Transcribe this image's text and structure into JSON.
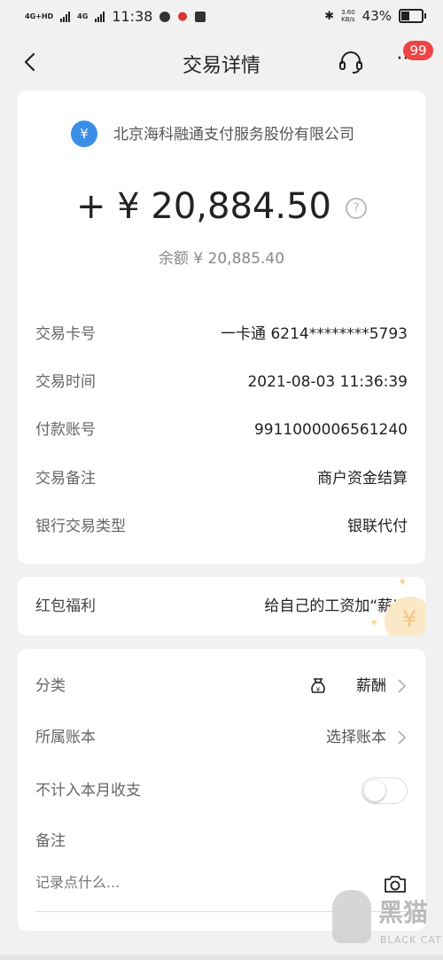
{
  "status_bar": {
    "net1": "4G+HD",
    "net2": "4G",
    "time": "11:38",
    "speed_value": "3.60",
    "speed_unit": "KB/s",
    "battery": "43%"
  },
  "header": {
    "title": "交易详情",
    "badge": "99"
  },
  "summary": {
    "merchant_icon": "¥",
    "merchant": "北京海科融通支付服务股份有限公司",
    "amount": "+ ¥ 20,884.50",
    "balance": "余额 ¥ 20,885.40"
  },
  "details": [
    {
      "label": "交易卡号",
      "value": "一卡通 6214********5793"
    },
    {
      "label": "交易时间",
      "value": "2021-08-03 11:36:39"
    },
    {
      "label": "付款账号",
      "value": "9911000006561240"
    },
    {
      "label": "交易备注",
      "value": "商户资金结算"
    },
    {
      "label": "银行交易类型",
      "value": "银联代付"
    }
  ],
  "welfare": {
    "label": "红包福利",
    "value": "给自己的工资加“薪”",
    "deco": "¥"
  },
  "category": {
    "label": "分类",
    "value": "薪酬"
  },
  "ledger": {
    "label": "所属账本",
    "value": "选择账本"
  },
  "exclude": {
    "label": "不计入本月收支",
    "on": false
  },
  "note": {
    "label": "备注",
    "placeholder": "记录点什么..."
  },
  "watermark": {
    "text": "黑猫",
    "sub": "BLACK CAT"
  }
}
